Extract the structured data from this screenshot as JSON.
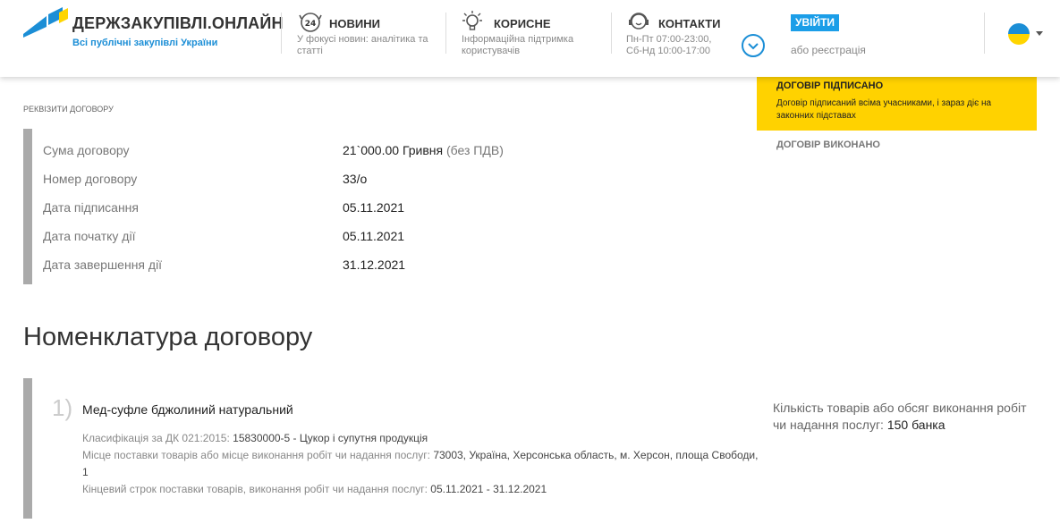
{
  "header": {
    "logo_title": "ДЕРЖЗАКУПІВЛІ.ОНЛАЙН",
    "logo_subtitle": "Всі публічні закупівлі України",
    "news_title": "НОВИНИ",
    "news_desc": "У фокусі новин: аналітика та статті",
    "news_badge": "24",
    "useful_title": "КОРИСНЕ",
    "useful_desc": "Інформаційна підтримка користувачів",
    "contacts_title": "КОНТАКТИ",
    "contacts_hours_1": "Пн-Пт 07:00-23:00,",
    "contacts_hours_2": "Сб-Нд 10:00-17:00",
    "login_label": "УВІЙТИ",
    "register_label": "або реєстрація"
  },
  "status": {
    "active_title": "ДОГОВІР ПІДПИСАНО",
    "active_desc": "Договір підписаний всіма учасниками, і зараз діє на законних підставах",
    "next_title": "ДОГОВІР ВИКОНАНО"
  },
  "details": {
    "section_label": "РЕКВІЗИТИ ДОГОВОРУ",
    "rows": [
      {
        "key": "Сума договору",
        "value": "21`000.00 Гривня",
        "unit": "(без ПДВ)"
      },
      {
        "key": "Номер договору",
        "value": "33/о"
      },
      {
        "key": "Дата підписання",
        "value": "05.11.2021"
      },
      {
        "key": "Дата початку дії",
        "value": "05.11.2021"
      },
      {
        "key": "Дата завершення дії",
        "value": "31.12.2021"
      }
    ]
  },
  "nomenclature": {
    "title": "Номенклатура договору",
    "items": [
      {
        "number": "1)",
        "name": "Мед-суфле бджолиний натуральний",
        "class_label": "Класифікація за ДК 021:2015:",
        "class_value": "15830000-5 - Цукор і супутня продукція",
        "place_label": "Місце поставки товарів або місце виконання робіт чи надання послуг:",
        "place_value": "73003, Україна, Херсонська область, м. Херсон, площа Свободи, 1",
        "term_label": "Кінцевий строк поставки товарів, виконання робіт чи надання послуг:",
        "term_value": "05.11.2021 - 31.12.2021",
        "qty_label": "Кількість товарів або обсяг виконання робіт чи надання послуг:",
        "qty_value": "150 банка"
      }
    ]
  },
  "colors": {
    "accent_blue": "#1b8ed6",
    "status_yellow": "#ffd200"
  }
}
